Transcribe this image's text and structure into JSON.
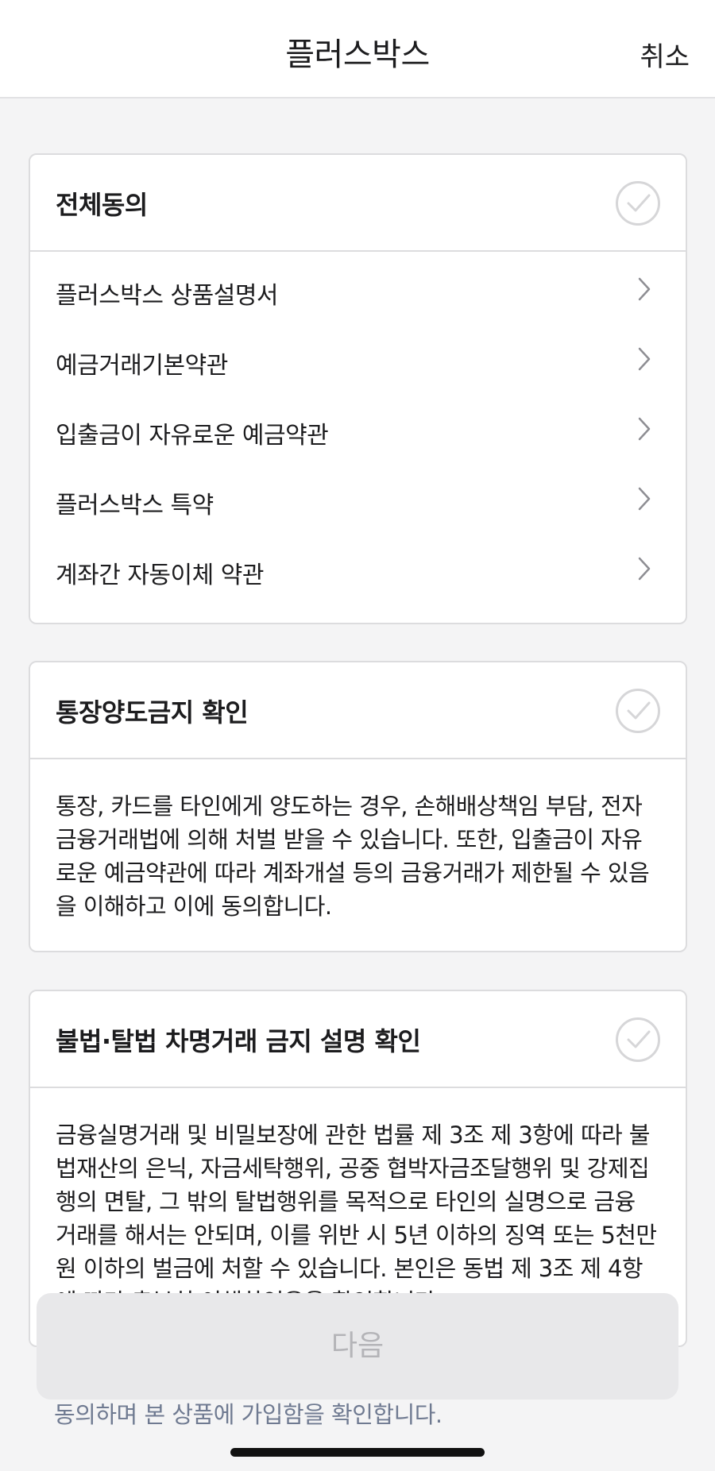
{
  "header": {
    "title": "플러스박스",
    "cancel_label": "취소"
  },
  "agree_all": {
    "title": "전체동의",
    "checked": false,
    "items": [
      {
        "label": "플러스박스 상품설명서"
      },
      {
        "label": "예금거래기본약관"
      },
      {
        "label": "입출금이 자유로운 예금약관"
      },
      {
        "label": "플러스박스 특약"
      },
      {
        "label": "계좌간 자동이체 약관"
      }
    ]
  },
  "transfer_ban": {
    "title": "통장양도금지 확인",
    "checked": false,
    "body": "통장, 카드를 타인에게 양도하는 경우, 손해배상책임 부담, 전자금융거래법에 의해 처벌 받을 수 있습니다. 또한, 입출금이 자유로운 예금약관에 따라 계좌개설 등의 금융거래가 제한될 수 있음을 이해하고 이에 동의합니다."
  },
  "illegal_borrowed_name": {
    "title": "불법·탈법 차명거래 금지 설명 확인",
    "checked": false,
    "body": "금융실명거래 및 비밀보장에 관한 법률 제 3조 제 3항에 따라 불법재산의 은닉, 자금세탁행위, 공중 협박자금조달행위 및 강제집행의 면탈, 그 밖의 탈법행위를 목적으로 타인의 실명으로 금융 거래를 해서는 안되며, 이를 위반 시 5년 이하의 징역 또는 5천만원 이하의 벌금에 처할 수 있습니다. 본인은 동법 제 3조 제 4항에 따라 충분히 이해하였음을 확인합니다."
  },
  "next_button": {
    "label": "다음",
    "enabled": false
  },
  "footer_note": "동의하며 본 상품에 가입함을 확인합니다.",
  "colors": {
    "background": "#f4f4f5",
    "card_border": "#dcdcde",
    "check_inactive": "#d6d6d8",
    "button_disabled_bg": "#e8e8ea",
    "button_disabled_text": "#b4b4b8",
    "footer_text": "#6f7a91"
  }
}
